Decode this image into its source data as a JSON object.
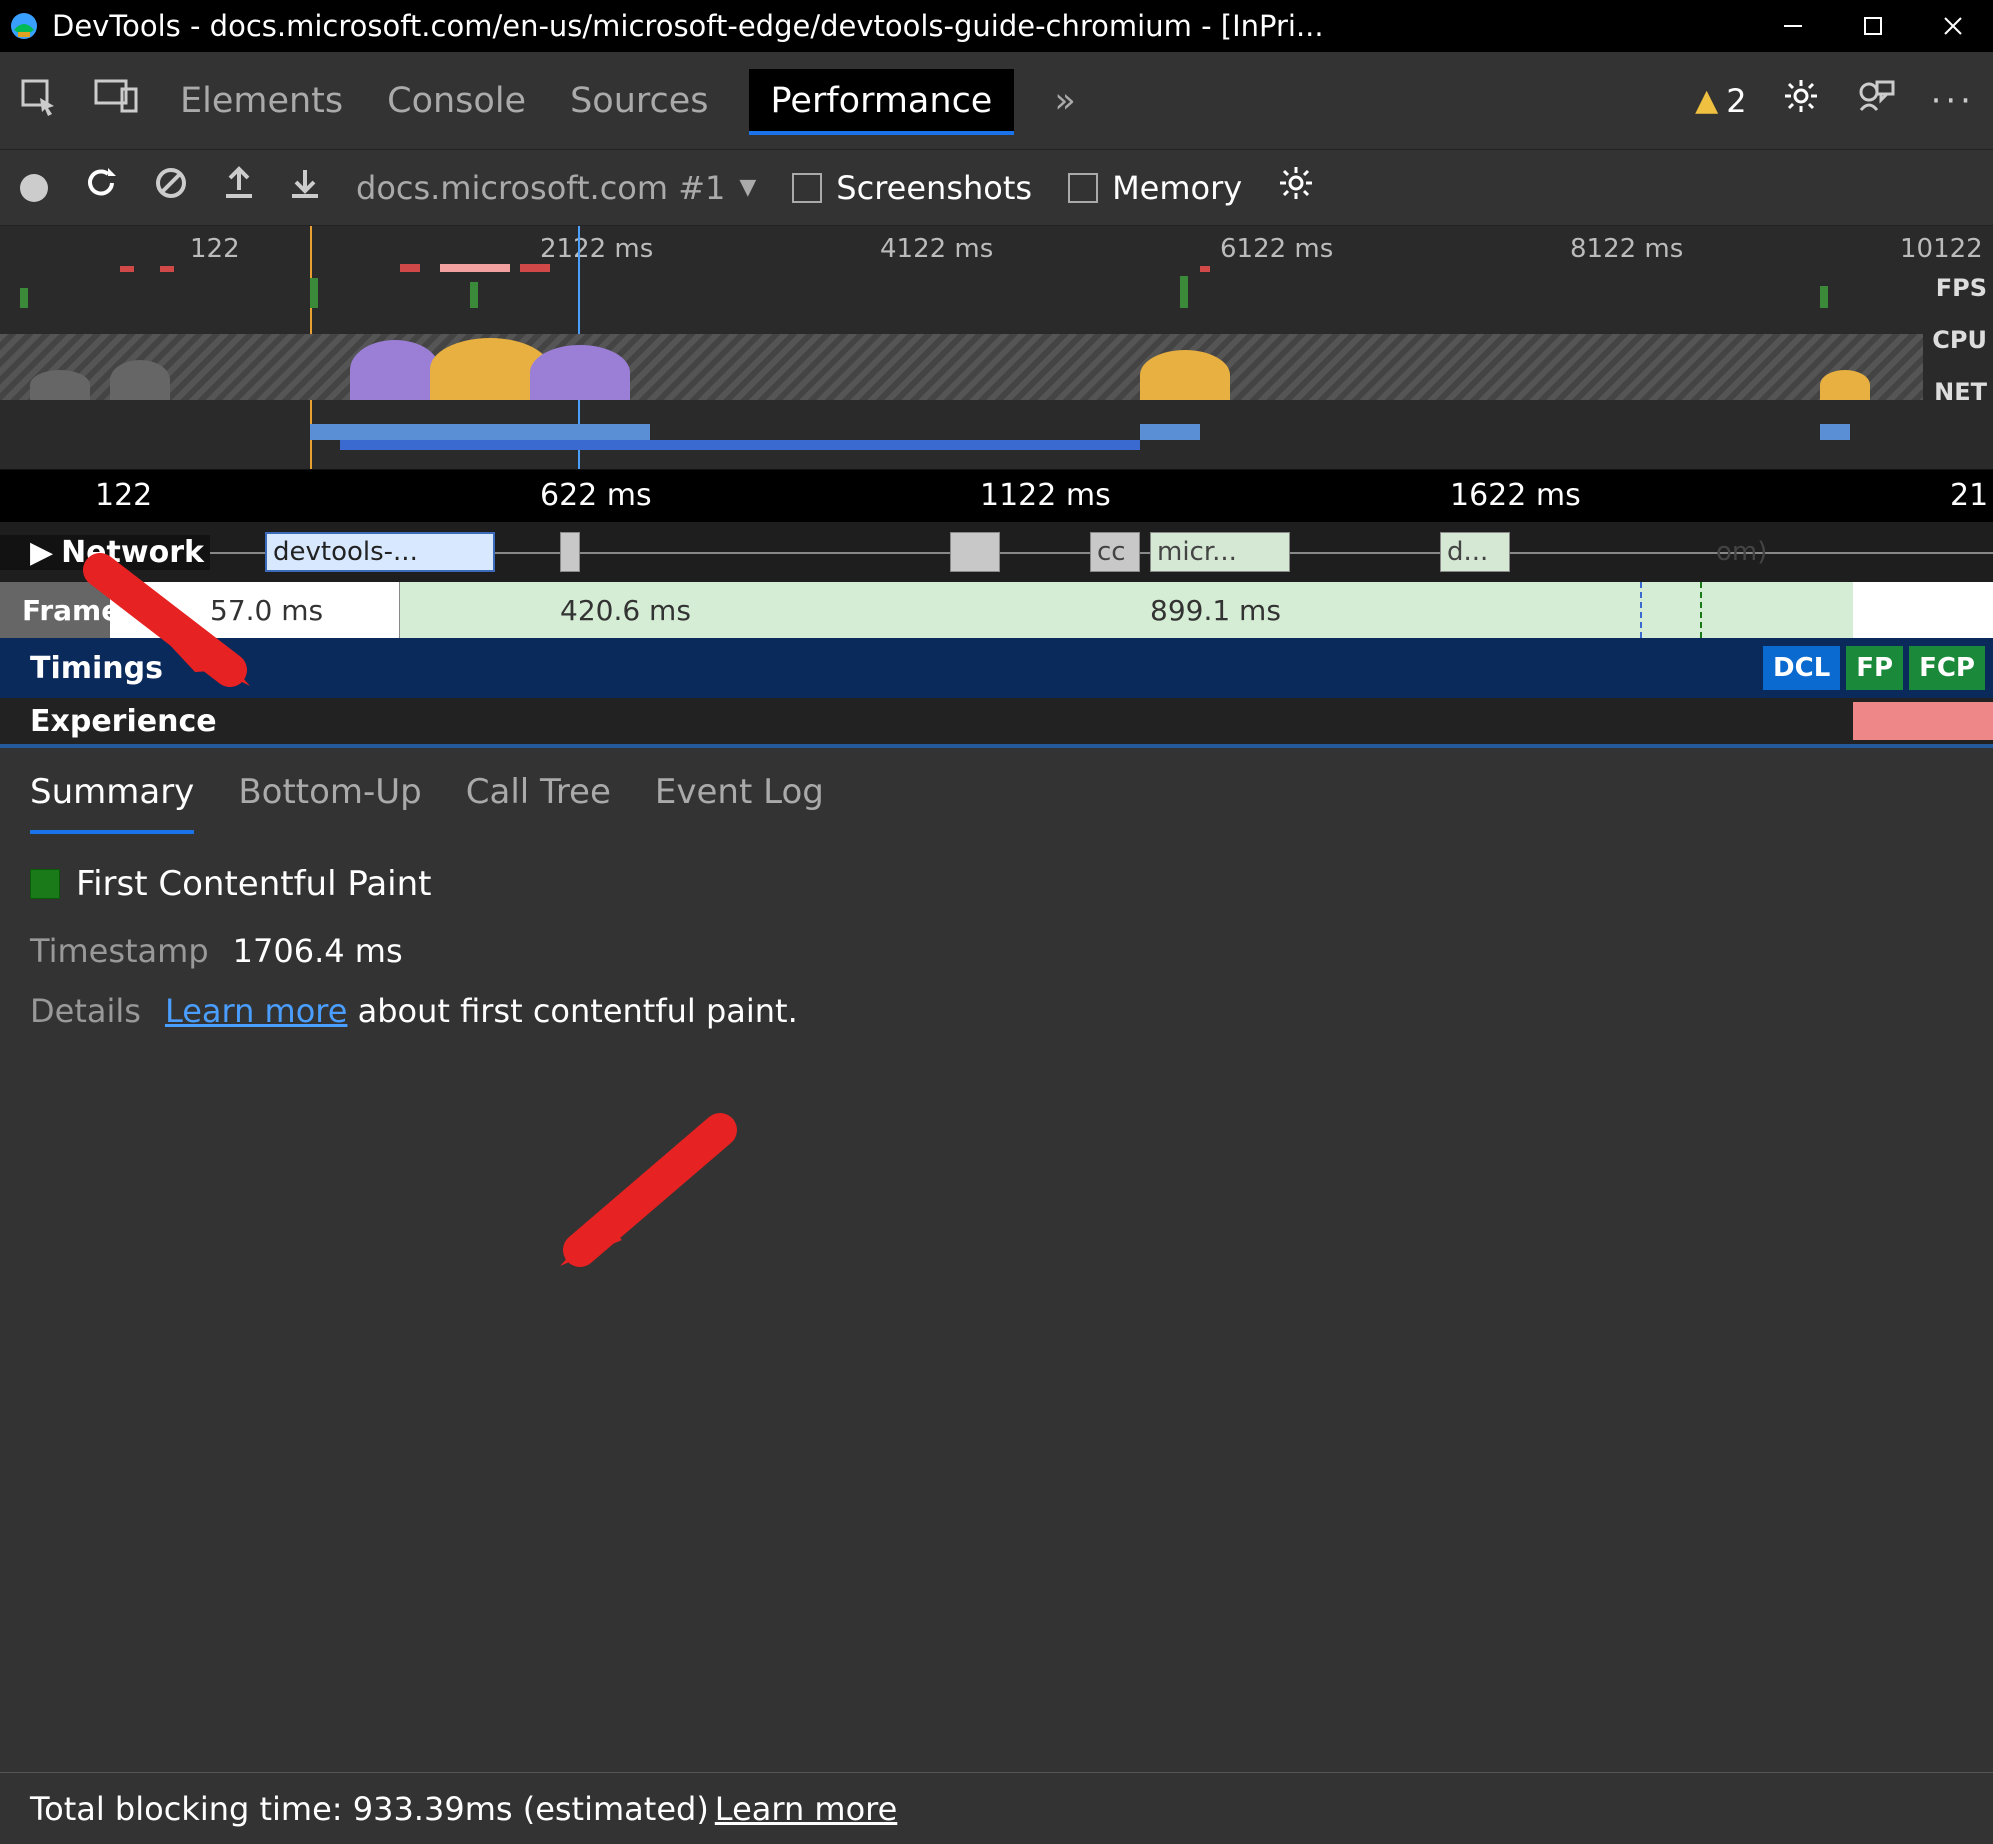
{
  "window": {
    "title": "DevTools - docs.microsoft.com/en-us/microsoft-edge/devtools-guide-chromium - [InPri..."
  },
  "tabs": {
    "elements": "Elements",
    "console": "Console",
    "sources": "Sources",
    "performance": "Performance",
    "more": "»",
    "warning_count": "2"
  },
  "toolbar": {
    "target": "docs.microsoft.com #1",
    "screenshots": "Screenshots",
    "memory": "Memory"
  },
  "overview": {
    "ticks": [
      "122",
      "2122 ms",
      "4122 ms",
      "6122 ms",
      "8122 ms",
      "10122"
    ],
    "labels": {
      "fps": "FPS",
      "cpu": "CPU",
      "net": "NET"
    }
  },
  "detail_ruler": [
    "122",
    "622 ms",
    "1122 ms",
    "1622 ms",
    "21"
  ],
  "network": {
    "label": "Network",
    "requests": [
      "devtools-...",
      "cc",
      "micr...",
      "d...",
      "om)"
    ]
  },
  "frames": {
    "label": "Frames",
    "values": [
      "57.0 ms",
      "420.6 ms",
      "899.1 ms"
    ]
  },
  "timings": {
    "label": "Timings",
    "marks": {
      "dcl": "DCL",
      "fp": "FP",
      "fcp": "FCP"
    }
  },
  "experience": {
    "label": "Experience"
  },
  "bottom_tabs": {
    "summary": "Summary",
    "bottomup": "Bottom-Up",
    "calltree": "Call Tree",
    "eventlog": "Event Log"
  },
  "summary": {
    "title": "First Contentful Paint",
    "timestamp_label": "Timestamp",
    "timestamp_value": "1706.4 ms",
    "details_label": "Details",
    "learn_more": "Learn more",
    "details_tail": " about first contentful paint."
  },
  "footer": {
    "text": "Total blocking time: 933.39ms (estimated) ",
    "learn_more": "Learn more"
  }
}
